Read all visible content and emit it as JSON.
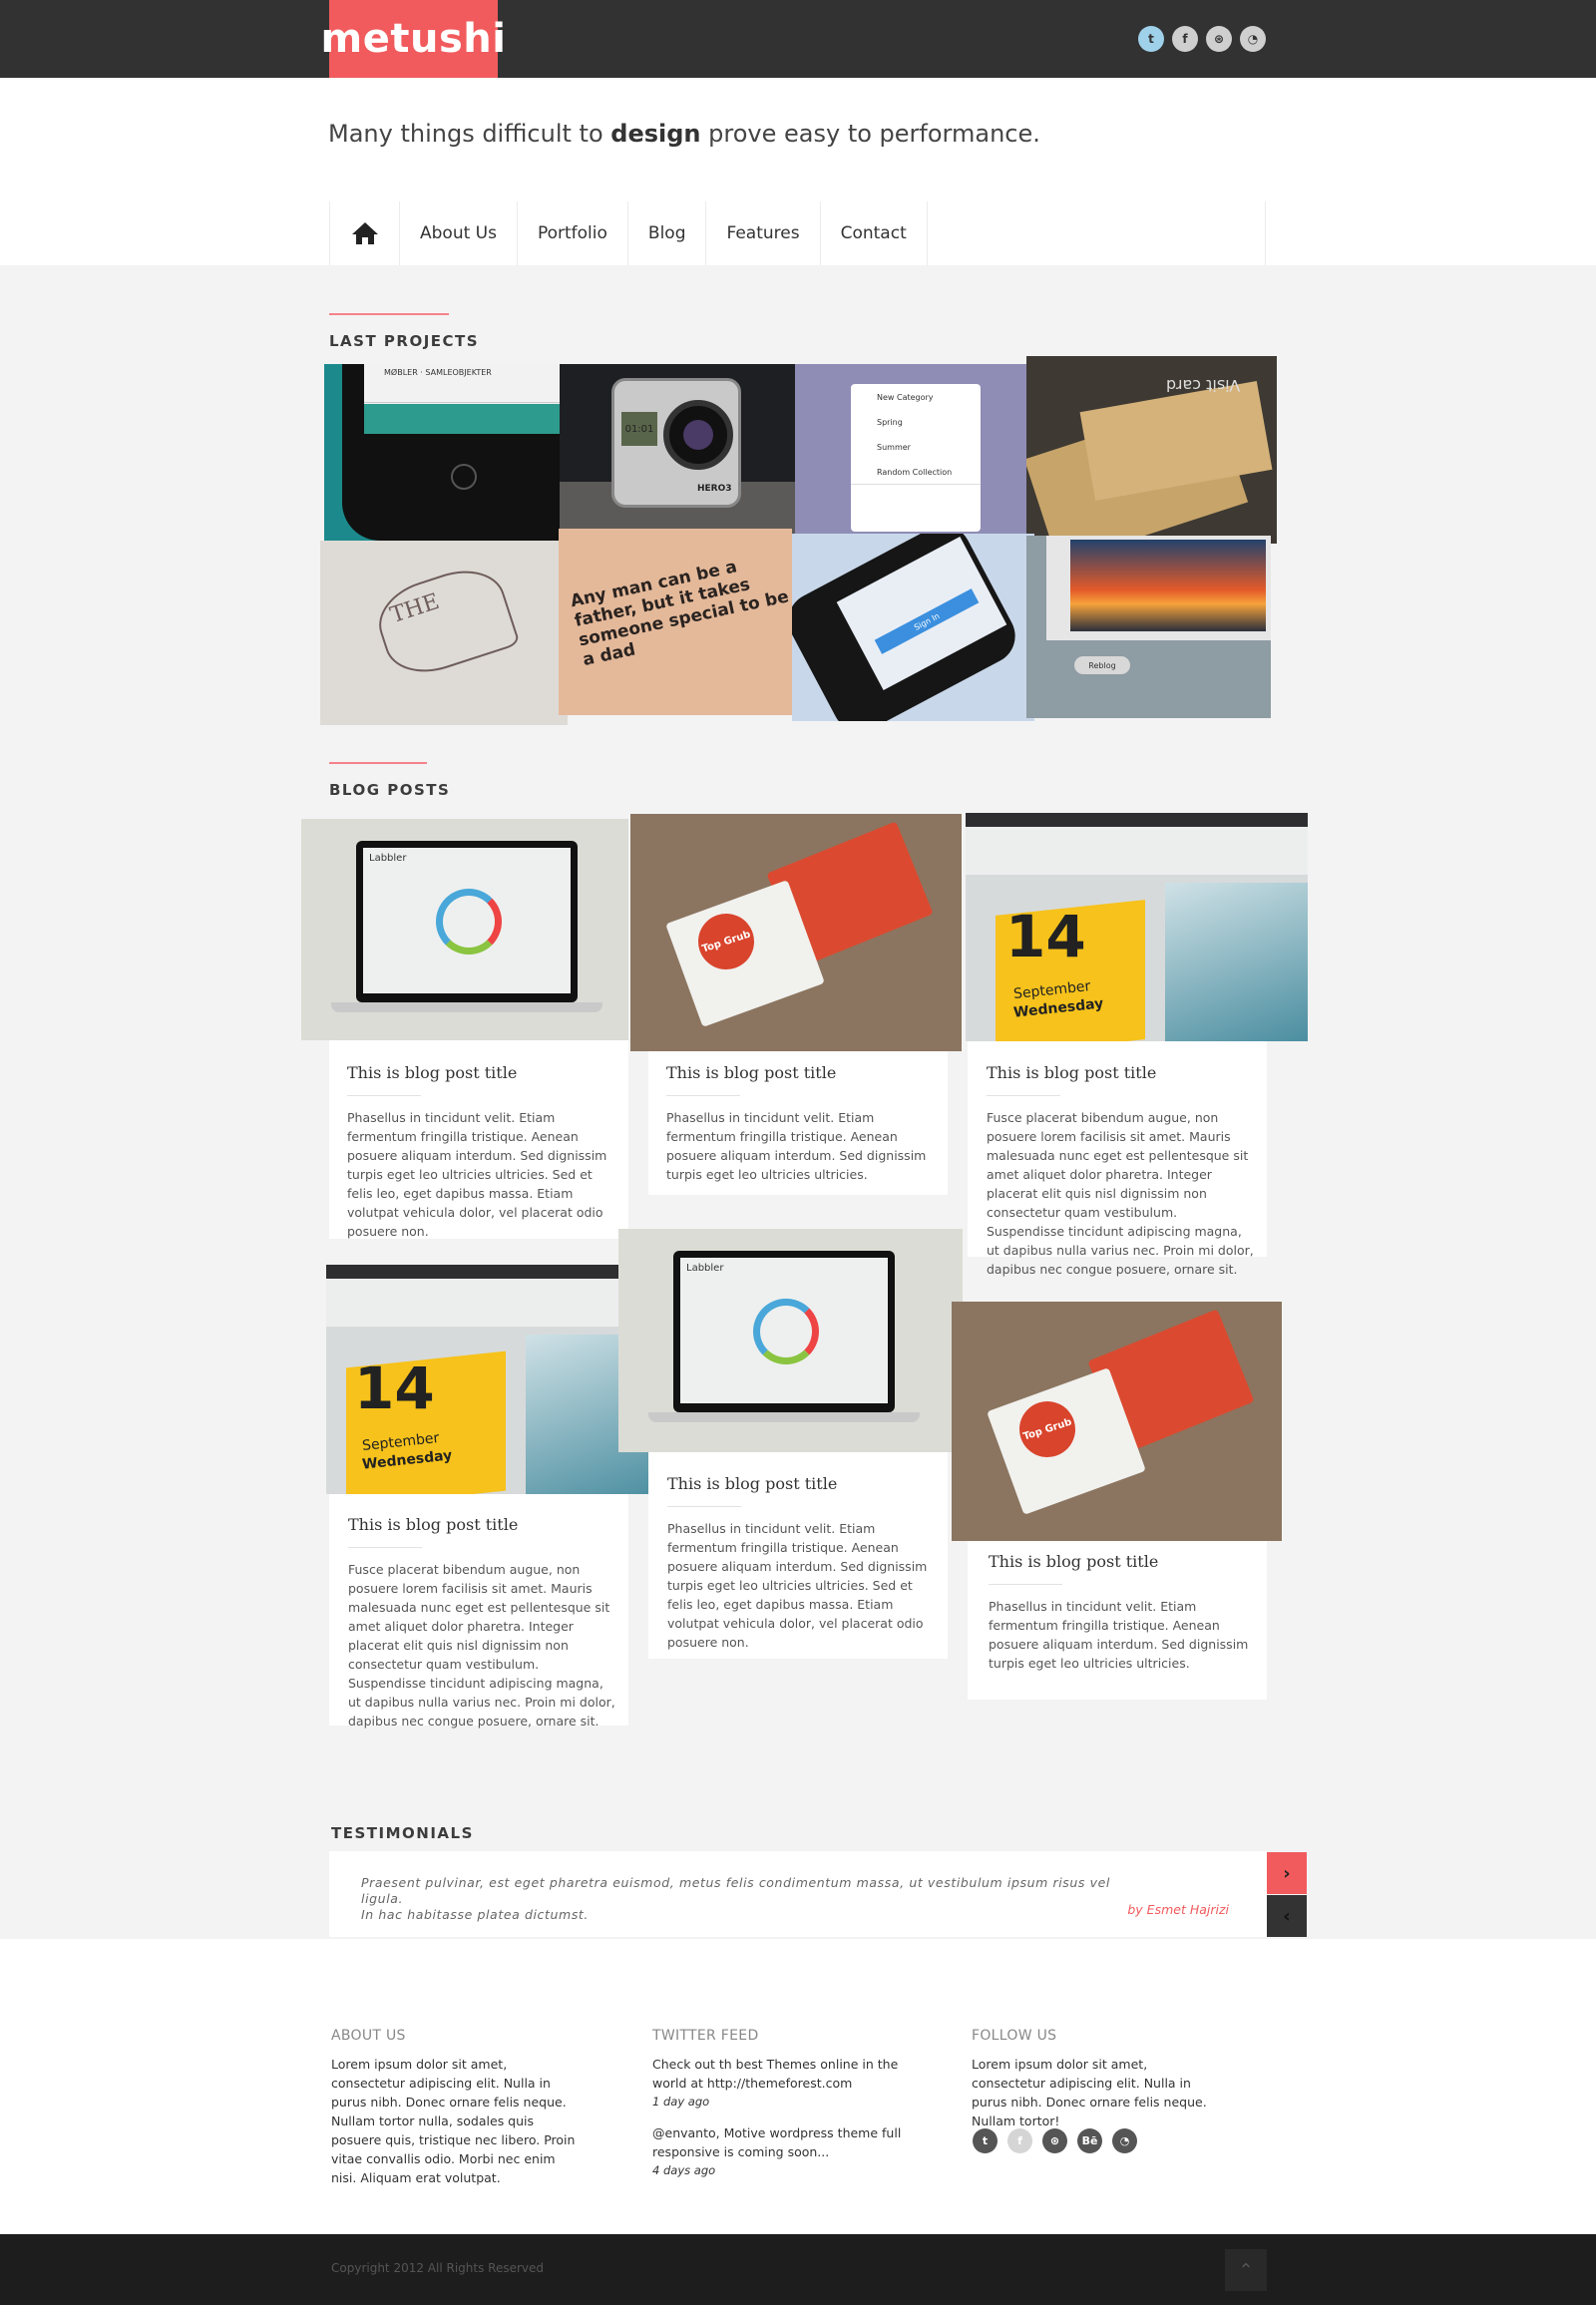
{
  "brand": {
    "name": "metushi",
    "accent": "#f15b5d"
  },
  "header": {
    "social": [
      {
        "icon": "twitter-icon",
        "glyph": "t"
      },
      {
        "icon": "facebook-icon",
        "glyph": "f"
      },
      {
        "icon": "dribbble-icon",
        "glyph": "⊛"
      },
      {
        "icon": "rss-icon",
        "glyph": "◔"
      }
    ],
    "tagline": {
      "before": "Many things difficult to",
      "bold": "design",
      "after": "prove easy to performance."
    }
  },
  "nav": {
    "home_icon": "home-icon",
    "items": [
      "About Us",
      "Portfolio",
      "Blog",
      "Features",
      "Contact"
    ]
  },
  "projects": {
    "title": "LAST PROJECTS",
    "tiles": [
      {
        "name": "project-app-mobile",
        "text": "MØBLER · SAMLEOBJEKTER"
      },
      {
        "name": "project-hero3-camera",
        "text": "HERO3"
      },
      {
        "name": "project-category-list",
        "lines": [
          "New Category",
          "Spring",
          "Summer",
          "Random Collection"
        ]
      },
      {
        "name": "project-visit-card",
        "text": "Visit card"
      },
      {
        "name": "project-sketch-badge",
        "text": "THE"
      },
      {
        "name": "project-quote-poster",
        "text": "Any man can be a father, but it takes someone special to be a dad"
      },
      {
        "name": "project-iphone-login",
        "text": "Sign In"
      },
      {
        "name": "project-sunset-screen",
        "text": "Reblog"
      }
    ]
  },
  "blog": {
    "title": "BLOG POSTS",
    "posts": [
      {
        "title": "This is blog post title",
        "text": "Phasellus in tincidunt velit. Etiam fermentum fringilla tristique. Aenean posuere aliquam interdum. Sed dignissim turpis eget leo ultricies ultricies. Sed et felis leo, eget dapibus massa. Etiam volutpat vehicula dolor, vel placerat odio posuere non."
      },
      {
        "title": "This is blog post title",
        "text": "Phasellus in tincidunt velit. Etiam fermentum fringilla tristique. Aenean posuere aliquam interdum. Sed dignissim turpis eget leo ultricies ultricies."
      },
      {
        "title": "This is blog post title",
        "text": "Fusce placerat bibendum augue, non posuere lorem facilisis sit amet. Mauris malesuada nunc eget est pellentesque sit amet aliquet dolor pharetra. Integer placerat elit quis nisl dignissim non consectetur quam vestibulum. Suspendisse tincidunt adipiscing magna, ut dapibus nulla varius nec. Proin mi dolor, dapibus nec congue posuere, ornare sit."
      },
      {
        "title": "This is blog post title",
        "text": "Fusce placerat bibendum augue, non posuere lorem facilisis sit amet. Mauris malesuada nunc eget est pellentesque sit amet aliquet dolor pharetra. Integer placerat elit quis nisl dignissim non consectetur quam vestibulum. Suspendisse tincidunt adipiscing magna, ut dapibus nulla varius nec. Proin mi dolor, dapibus nec congue posuere, ornare sit."
      },
      {
        "title": "This is blog post title",
        "text": "Phasellus in tincidunt velit. Etiam fermentum fringilla tristique. Aenean posuere aliquam interdum. Sed dignissim turpis eget leo ultricies ultricies. Sed et felis leo, eget dapibus massa. Etiam volutpat vehicula dolor, vel placerat odio posuere non."
      },
      {
        "title": "This is blog post title",
        "text": "Phasellus in tincidunt velit. Etiam fermentum fringilla tristique. Aenean posuere aliquam interdum. Sed dignissim turpis eget leo ultricies ultricies."
      }
    ],
    "image_labels": {
      "calendar_day": "14",
      "calendar_month": "September",
      "calendar_weekday": "Wednesday",
      "card_brand": "Top Grub",
      "app_name": "Labbler"
    }
  },
  "testimonials": {
    "title": "TESTIMONIALS",
    "quote_line1": "Praesent pulvinar, est eget pharetra euismod, metus felis condimentum massa, ut vestibulum ipsum risus vel ligula.",
    "quote_line2": "In hac habitasse platea dictumst.",
    "author": "by Esmet Hajrizi",
    "next_glyph": "›",
    "prev_glyph": "‹"
  },
  "footer": {
    "about": {
      "heading": "ABOUT US",
      "text": "Lorem ipsum dolor sit amet, consectetur adipiscing elit. Nulla in purus nibh. Donec ornare felis neque. Nullam tortor nulla, sodales quis posuere quis, tristique nec libero. Proin vitae convallis odio. Morbi nec enim nisi. Aliquam erat volutpat."
    },
    "twitter": {
      "heading": "TWITTER FEED",
      "tweets": [
        {
          "text": "Check out th best Themes online in the world at http://themeforest.com",
          "time": "1 day ago"
        },
        {
          "text": "@envanto, Motive wordpress theme full responsive is coming soon...",
          "time": "4 days ago"
        }
      ]
    },
    "follow": {
      "heading": "FOLLOW US",
      "text": "Lorem ipsum dolor sit amet, consectetur adipiscing elit. Nulla in purus nibh. Donec ornare felis neque. Nullam tortor!",
      "icons": [
        {
          "icon": "twitter-icon",
          "glyph": "t"
        },
        {
          "icon": "facebook-icon",
          "glyph": "f"
        },
        {
          "icon": "dribbble-icon",
          "glyph": "⊛"
        },
        {
          "icon": "behance-icon",
          "glyph": "Bē"
        },
        {
          "icon": "rss-icon",
          "glyph": "◔"
        }
      ]
    },
    "copyright": "Copyright 2012 All Rights Reserved",
    "totop_glyph": "⌃"
  }
}
